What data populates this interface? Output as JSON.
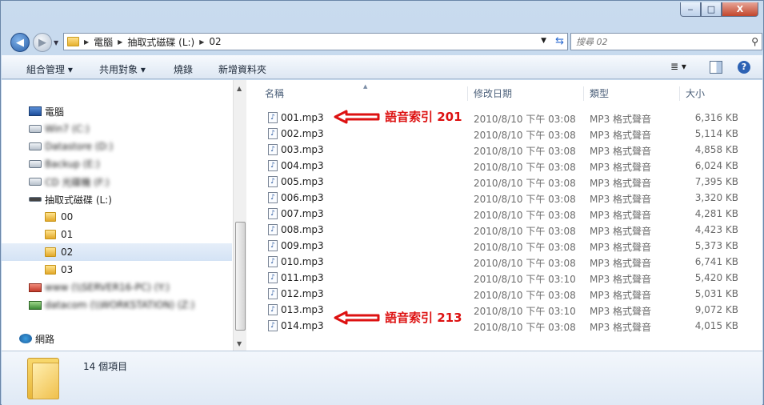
{
  "window": {
    "caption_buttons": {
      "minimize": "‒",
      "maximize": "□",
      "close": "X"
    }
  },
  "address": {
    "crumbs": [
      "電腦",
      "抽取式磁碟 (L:)",
      "02"
    ],
    "search_placeholder": "搜尋 02"
  },
  "toolbar": {
    "organize": "組合管理 ▾",
    "share": "共用對象 ▾",
    "burn": "燒錄",
    "new_folder": "新增資料夾",
    "view_icon": "≣ ▾",
    "help_icon": "?"
  },
  "nav": {
    "computer": "電腦",
    "drive_c": "Win7 (C:)",
    "drive_d": "Datastore (D:)",
    "drive_e": "Backup (E:)",
    "drive_f": "CD 光碟機 (F:)",
    "drive_l": "抽取式磁碟 (L:)",
    "folders": [
      "00",
      "01",
      "02",
      "03"
    ],
    "net_y": "www (\\\\SERVER16-PC) (Y:)",
    "net_z": "datacom (\\\\WORKSTATION) (Z:)",
    "network": "網路"
  },
  "columns": {
    "name": "名稱",
    "date": "修改日期",
    "type": "類型",
    "size": "大小"
  },
  "files": [
    {
      "name": "001.mp3",
      "date": "2010/8/10 下午 03:08",
      "type": "MP3 格式聲音",
      "size": "6,316 KB"
    },
    {
      "name": "002.mp3",
      "date": "2010/8/10 下午 03:08",
      "type": "MP3 格式聲音",
      "size": "5,114 KB"
    },
    {
      "name": "003.mp3",
      "date": "2010/8/10 下午 03:08",
      "type": "MP3 格式聲音",
      "size": "4,858 KB"
    },
    {
      "name": "004.mp3",
      "date": "2010/8/10 下午 03:08",
      "type": "MP3 格式聲音",
      "size": "6,024 KB"
    },
    {
      "name": "005.mp3",
      "date": "2010/8/10 下午 03:08",
      "type": "MP3 格式聲音",
      "size": "7,395 KB"
    },
    {
      "name": "006.mp3",
      "date": "2010/8/10 下午 03:08",
      "type": "MP3 格式聲音",
      "size": "3,320 KB"
    },
    {
      "name": "007.mp3",
      "date": "2010/8/10 下午 03:08",
      "type": "MP3 格式聲音",
      "size": "4,281 KB"
    },
    {
      "name": "008.mp3",
      "date": "2010/8/10 下午 03:08",
      "type": "MP3 格式聲音",
      "size": "4,423 KB"
    },
    {
      "name": "009.mp3",
      "date": "2010/8/10 下午 03:08",
      "type": "MP3 格式聲音",
      "size": "5,373 KB"
    },
    {
      "name": "010.mp3",
      "date": "2010/8/10 下午 03:08",
      "type": "MP3 格式聲音",
      "size": "6,741 KB"
    },
    {
      "name": "011.mp3",
      "date": "2010/8/10 下午 03:10",
      "type": "MP3 格式聲音",
      "size": "5,420 KB"
    },
    {
      "name": "012.mp3",
      "date": "2010/8/10 下午 03:08",
      "type": "MP3 格式聲音",
      "size": "5,031 KB"
    },
    {
      "name": "013.mp3",
      "date": "2010/8/10 下午 03:10",
      "type": "MP3 格式聲音",
      "size": "9,072 KB"
    },
    {
      "name": "014.mp3",
      "date": "2010/8/10 下午 03:08",
      "type": "MP3 格式聲音",
      "size": "4,015 KB"
    }
  ],
  "annotations": [
    "語音索引 201",
    "語音索引 213"
  ],
  "details": {
    "item_count": "14 個項目"
  },
  "colors": {
    "annotation": "#dd1111",
    "selected_nav": "#d4e3f5"
  }
}
